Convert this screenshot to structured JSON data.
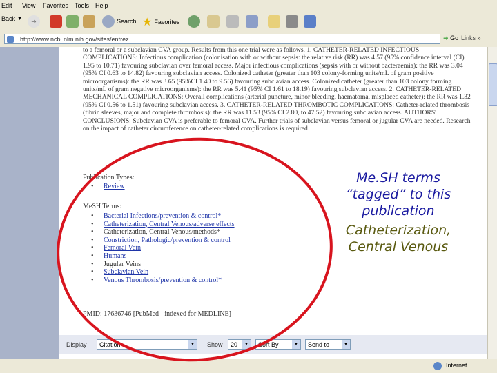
{
  "menu": [
    "Edit",
    "View",
    "Favorites",
    "Tools",
    "Help"
  ],
  "toolbar": {
    "back": "Back",
    "search": "Search",
    "favorites": "Favorites"
  },
  "address": {
    "url": "http://www.ncbi.nlm.nih.gov/sites/entrez",
    "go": "Go",
    "links": "Links"
  },
  "abstract_text": "to a femoral or a subclavian CVA group. Results from this one trial were as follows. 1. CATHETER-RELATED INFECTIOUS COMPLICATIONS: Infectious complication (colonisation with or without sepsis: the relative risk (RR) was 4.57 (95% confidence interval (CI) 1.95 to 10.71) favouring subclavian over femoral access. Major infectious complications (sepsis with or without bacteraemia): the RR was 3.04 (95% CI 0.63 to 14.82) favouring subclavian access. Colonized catheter (greater than 103 colony-forming units/mL of gram positive microorganisms): the RR was 3.65 (95%CI 1.40 to 9.56) favouring subclavian access. Colonized catheter (greater than 103 colony forming units/mL of gram negative microorganisms): the RR was 5.41 (95% CI 1.61 to 18.19) favouring subclavian access. 2. CATHETER-RELATED MECHANICAL COMPLICATIONS: Overall complications (arterial puncture, minor bleeding, haematoma, misplaced catheter): the RR was 1.32 (95% CI 0.56 to 1.51) favouring subclavian access. 3. CATHETER-RELATED THROMBOTIC COMPLICATIONS: Catheter-related thrombosis (fibrin sleeves, major and complete thrombosis): the RR was 11.53 (95% CI 2.80, to 47.52) favouring subclavian access. AUTHORS' CONCLUSIONS: Subclavian CVA is preferable to femoral CVA. Further trials of subclavian versus femoral or jugular CVA are needed. Research on the impact of catheter circumference on catheter-related complications is required.",
  "publication_types": {
    "heading": "Publication Types:",
    "items": [
      "Review"
    ]
  },
  "mesh": {
    "heading": "MeSH Terms:",
    "items": [
      {
        "text": "Bacterial Infections/prevention & control*",
        "link": true
      },
      {
        "text": "Catheterization, Central Venous/adverse effects",
        "link": true
      },
      {
        "text": "Catheterization, Central Venous/methods*",
        "link": false
      },
      {
        "text": "Constriction, Pathologic/prevention & control",
        "link": true
      },
      {
        "text": "Femoral Vein",
        "link": true
      },
      {
        "text": "Humans",
        "link": true
      },
      {
        "text": "Jugular Veins",
        "link": false
      },
      {
        "text": "Subclavian Vein",
        "link": true
      },
      {
        "text": "Venous Thrombosis/prevention & control*",
        "link": true
      }
    ]
  },
  "pmid": "PMID: 17636746 [PubMed - indexed for MEDLINE]",
  "display_bar": {
    "display_label": "Display",
    "format": "Citation",
    "show_label": "Show",
    "show_value": "20",
    "sort": "Sort By",
    "send": "Send to"
  },
  "status": {
    "zone": "Internet"
  },
  "annotation": {
    "title": "Me.SH terms “tagged” to this publication",
    "example": "Catheterization, Central Venous"
  },
  "colors": {
    "oval": "#d8141e",
    "annotation_title": "#1a1aa0",
    "annotation_example": "#5a5a10",
    "link": "#1f35a8",
    "sidebar": "#a9b3c9"
  }
}
